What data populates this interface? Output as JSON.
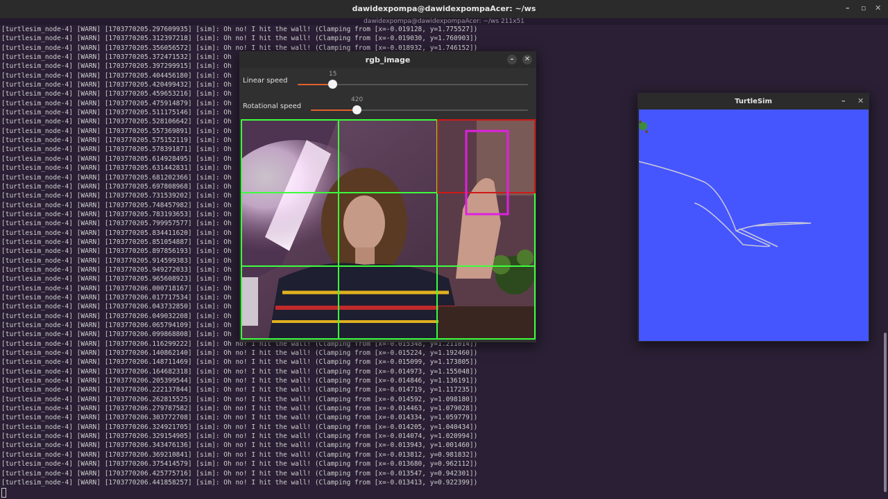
{
  "terminal": {
    "title": "dawidexpompa@dawidexpompaAcer: ~/ws",
    "subtitle": "dawidexpompa@dawidexpompaAcer: ~/ws 211x51",
    "lines": [
      "[turtlesim_node-4] [WARN] [1703770205.297609935] [sim]: Oh no! I hit the wall! (Clamping from [x=-0.019128, y=1.775527])",
      "[turtlesim_node-4] [WARN] [1703770205.312397218] [sim]: Oh no! I hit the wall! (Clamping from [x=-0.019030, y=1.760903])",
      "[turtlesim_node-4] [WARN] [1703770205.356056572] [sim]: Oh no! I hit the wall! (Clamping from [x=-0.018932, y=1.746152])",
      "[turtlesim_node-4] [WARN] [1703770205.372471532] [sim]: Oh",
      "[turtlesim_node-4] [WARN] [1703770205.397299915] [sim]: Oh",
      "[turtlesim_node-4] [WARN] [1703770205.404456180] [sim]: Oh",
      "[turtlesim_node-4] [WARN] [1703770205.420499432] [sim]: Oh",
      "[turtlesim_node-4] [WARN] [1703770205.459653216] [sim]: Oh",
      "[turtlesim_node-4] [WARN] [1703770205.475914879] [sim]: Oh",
      "[turtlesim_node-4] [WARN] [1703770205.511175146] [sim]: Oh",
      "[turtlesim_node-4] [WARN] [1703770205.528106642] [sim]: Oh",
      "[turtlesim_node-4] [WARN] [1703770205.557369891] [sim]: Oh",
      "[turtlesim_node-4] [WARN] [1703770205.575152119] [sim]: Oh",
      "[turtlesim_node-4] [WARN] [1703770205.578391871] [sim]: Oh",
      "[turtlesim_node-4] [WARN] [1703770205.614928495] [sim]: Oh",
      "[turtlesim_node-4] [WARN] [1703770205.631442831] [sim]: Oh",
      "[turtlesim_node-4] [WARN] [1703770205.681202366] [sim]: Oh",
      "[turtlesim_node-4] [WARN] [1703770205.697808968] [sim]: Oh",
      "[turtlesim_node-4] [WARN] [1703770205.731539202] [sim]: Oh",
      "[turtlesim_node-4] [WARN] [1703770205.748457982] [sim]: Oh",
      "[turtlesim_node-4] [WARN] [1703770205.783193653] [sim]: Oh",
      "[turtlesim_node-4] [WARN] [1703770205.799957577] [sim]: Oh",
      "[turtlesim_node-4] [WARN] [1703770205.834411620] [sim]: Oh",
      "[turtlesim_node-4] [WARN] [1703770205.851054887] [sim]: Oh",
      "[turtlesim_node-4] [WARN] [1703770205.897856193] [sim]: Oh",
      "[turtlesim_node-4] [WARN] [1703770205.914599383] [sim]: Oh",
      "[turtlesim_node-4] [WARN] [1703770205.949272033] [sim]: Oh",
      "[turtlesim_node-4] [WARN] [1703770205.965608923] [sim]: Oh",
      "[turtlesim_node-4] [WARN] [1703770206.000718167] [sim]: Oh",
      "[turtlesim_node-4] [WARN] [1703770206.017717534] [sim]: Oh",
      "[turtlesim_node-4] [WARN] [1703770206.043732850] [sim]: Oh",
      "[turtlesim_node-4] [WARN] [1703770206.049032208] [sim]: Oh",
      "[turtlesim_node-4] [WARN] [1703770206.065794109] [sim]: Oh",
      "[turtlesim_node-4] [WARN] [1703770206.099868808] [sim]: Oh",
      "[turtlesim_node-4] [WARN] [1703770206.116299222] [sim]: Oh no! I hit the wall! (Clamping from [x=-0.015348, y=1.211014])",
      "[turtlesim_node-4] [WARN] [1703770206.140862140] [sim]: Oh no! I hit the wall! (Clamping from [x=-0.015224, y=1.192460])",
      "[turtlesim_node-4] [WARN] [1703770206.148711469] [sim]: Oh no! I hit the wall! (Clamping from [x=-0.015099, y=1.173805])",
      "[turtlesim_node-4] [WARN] [1703770206.164682318] [sim]: Oh no! I hit the wall! (Clamping from [x=-0.014973, y=1.155048])",
      "[turtlesim_node-4] [WARN] [1703770206.205399544] [sim]: Oh no! I hit the wall! (Clamping from [x=-0.014846, y=1.136191])",
      "[turtlesim_node-4] [WARN] [1703770206.222137844] [sim]: Oh no! I hit the wall! (Clamping from [x=-0.014719, y=1.117235])",
      "[turtlesim_node-4] [WARN] [1703770206.262815525] [sim]: Oh no! I hit the wall! (Clamping from [x=-0.014592, y=1.098180])",
      "[turtlesim_node-4] [WARN] [1703770206.279787582] [sim]: Oh no! I hit the wall! (Clamping from [x=-0.014463, y=1.079028])",
      "[turtlesim_node-4] [WARN] [1703770206.303772708] [sim]: Oh no! I hit the wall! (Clamping from [x=-0.014334, y=1.059779])",
      "[turtlesim_node-4] [WARN] [1703770206.324921705] [sim]: Oh no! I hit the wall! (Clamping from [x=-0.014205, y=1.040434])",
      "[turtlesim_node-4] [WARN] [1703770206.329154905] [sim]: Oh no! I hit the wall! (Clamping from [x=-0.014074, y=1.020994])",
      "[turtlesim_node-4] [WARN] [1703770206.343476136] [sim]: Oh no! I hit the wall! (Clamping from [x=-0.013943, y=1.001460])",
      "[turtlesim_node-4] [WARN] [1703770206.369210841] [sim]: Oh no! I hit the wall! (Clamping from [x=-0.013812, y=0.981832])",
      "[turtlesim_node-4] [WARN] [1703770206.375414579] [sim]: Oh no! I hit the wall! (Clamping from [x=-0.013680, y=0.962112])",
      "[turtlesim_node-4] [WARN] [1703770206.425775716] [sim]: Oh no! I hit the wall! (Clamping from [x=-0.013547, y=0.942301])",
      "[turtlesim_node-4] [WARN] [1703770206.441858257] [sim]: Oh no! I hit the wall! (Clamping from [x=-0.013413, y=0.922399])"
    ]
  },
  "rgb_window": {
    "title": "rgb_image",
    "linear_speed": {
      "label": "Linear speed",
      "value": "15",
      "fraction": 0.15
    },
    "rotational_speed": {
      "label": "Rotational speed",
      "value": "420",
      "fraction": 0.21
    },
    "colors": {
      "accent": "#e0612f",
      "grid": "#3dff3d",
      "active_cell": "#d01818",
      "hand_box": "#e020e0"
    }
  },
  "turtle_window": {
    "title": "TurtleSim",
    "background": "#4556ff",
    "icons": [
      "turtle-icon",
      "minimize-icon",
      "close-icon"
    ]
  }
}
